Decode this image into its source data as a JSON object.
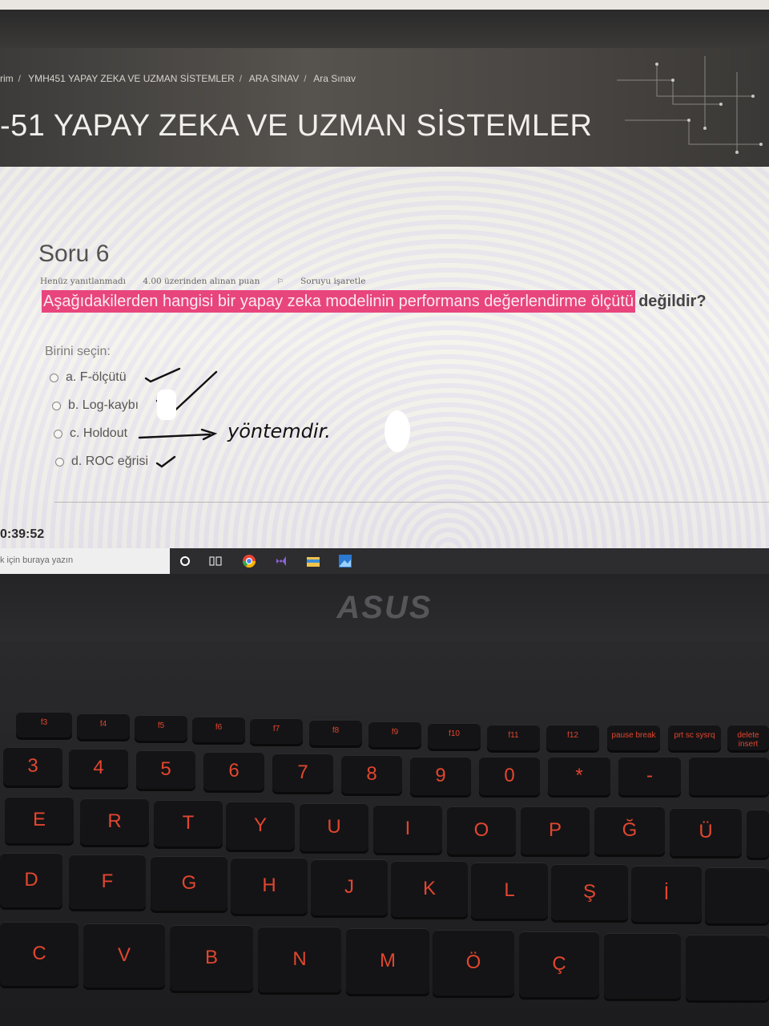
{
  "breadcrumb": {
    "items": [
      "rim",
      "YMH451 YAPAY ZEKA VE UZMAN SİSTEMLER",
      "ARA SINAV",
      "Ara Sınav"
    ],
    "separator": "/"
  },
  "course": {
    "title": "-51 YAPAY ZEKA VE UZMAN SİSTEMLER"
  },
  "question": {
    "title": "Soru 6",
    "status": "Henüz yanıtlanmadı",
    "points": "4.00 üzerinden alınan puan",
    "flag_label": "Soruyu işaretle",
    "text_highlighted": "Aşağıdakilerden hangisi bir yapay zeka modelinin performans değerlendirme ölçütü",
    "text_bold": "değildir?",
    "instruction": "Birini seçin:",
    "options": [
      {
        "label": "a. F-ölçütü"
      },
      {
        "label": "b. Log-kaybı"
      },
      {
        "label": "c. Holdout"
      },
      {
        "label": "d. ROC eğrisi"
      }
    ]
  },
  "annotation": {
    "handwritten_note": "yöntemdir."
  },
  "timer": {
    "value": "0:39:52"
  },
  "taskbar": {
    "search_placeholder": "k için buraya yazın",
    "icons": [
      "cortana-icon",
      "task-view-icon",
      "chrome-icon",
      "visual-studio-icon",
      "file-explorer-icon",
      "photos-icon"
    ]
  },
  "laptop": {
    "brand": "ASUS"
  },
  "keyboard": {
    "fn_row": [
      "f3",
      "f4",
      "f5",
      "f6",
      "f7",
      "f8",
      "f9",
      "f10",
      "f11",
      "f12",
      "pause break",
      "prt sc sysrq",
      "delete insert"
    ],
    "number_row": [
      "3",
      "4",
      "5",
      "6",
      "7",
      "8",
      "9",
      "0",
      "*",
      "-"
    ],
    "top_row": [
      "E",
      "R",
      "T",
      "Y",
      "U",
      "I",
      "O",
      "P",
      "Ğ",
      "Ü"
    ],
    "home_row": [
      "D",
      "F",
      "G",
      "H",
      "J",
      "K",
      "L",
      "Ş",
      "İ"
    ],
    "bottom_row": [
      "C",
      "V",
      "B",
      "N",
      "M",
      "Ö",
      "Ç"
    ]
  },
  "colors": {
    "highlight": "#e8457d",
    "key_legend": "#e2462e",
    "accent_button": "#c2306a"
  }
}
